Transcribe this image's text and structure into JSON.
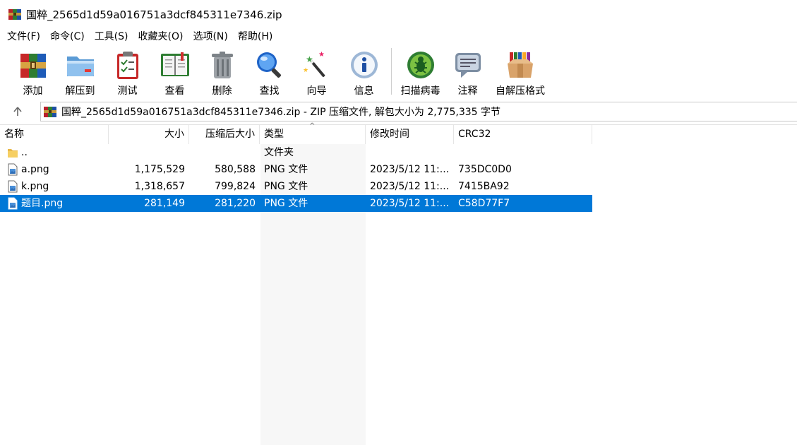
{
  "window": {
    "title": "国粹_2565d1d59a016751a3dcf845311e7346.zip"
  },
  "menu": [
    "文件(F)",
    "命令(C)",
    "工具(S)",
    "收藏夹(O)",
    "选项(N)",
    "帮助(H)"
  ],
  "toolbar": {
    "add": "添加",
    "extract": "解压到",
    "test": "测试",
    "view": "查看",
    "delete": "删除",
    "find": "查找",
    "wizard": "向导",
    "info": "信息",
    "scan": "扫描病毒",
    "comment": "注释",
    "sfx": "自解压格式"
  },
  "address": {
    "path": "国粹_2565d1d59a016751a3dcf845311e7346.zip - ZIP 压缩文件, 解包大小为 2,775,335 字节"
  },
  "columns": {
    "name": "名称",
    "size": "大小",
    "packed": "压缩后大小",
    "type": "类型",
    "modified": "修改时间",
    "crc": "CRC32"
  },
  "rows": [
    {
      "name": "..",
      "size": "",
      "packed": "",
      "type": "文件夹",
      "modified": "",
      "crc": "",
      "icon": "folder-icon"
    },
    {
      "name": "a.png",
      "size": "1,175,529",
      "packed": "580,588",
      "type": "PNG 文件",
      "modified": "2023/5/12 11:...",
      "crc": "735DC0D0",
      "icon": "png-file-icon"
    },
    {
      "name": "k.png",
      "size": "1,318,657",
      "packed": "799,824",
      "type": "PNG 文件",
      "modified": "2023/5/12 11:...",
      "crc": "7415BA92",
      "icon": "png-file-icon"
    },
    {
      "name": "题目.png",
      "size": "281,149",
      "packed": "281,220",
      "type": "PNG 文件",
      "modified": "2023/5/12 11:...",
      "crc": "C58D77F7",
      "icon": "png-file-icon",
      "selected": true
    }
  ],
  "colors": {
    "selection": "#0078d7",
    "sorted_column": "#f7f7f7"
  }
}
